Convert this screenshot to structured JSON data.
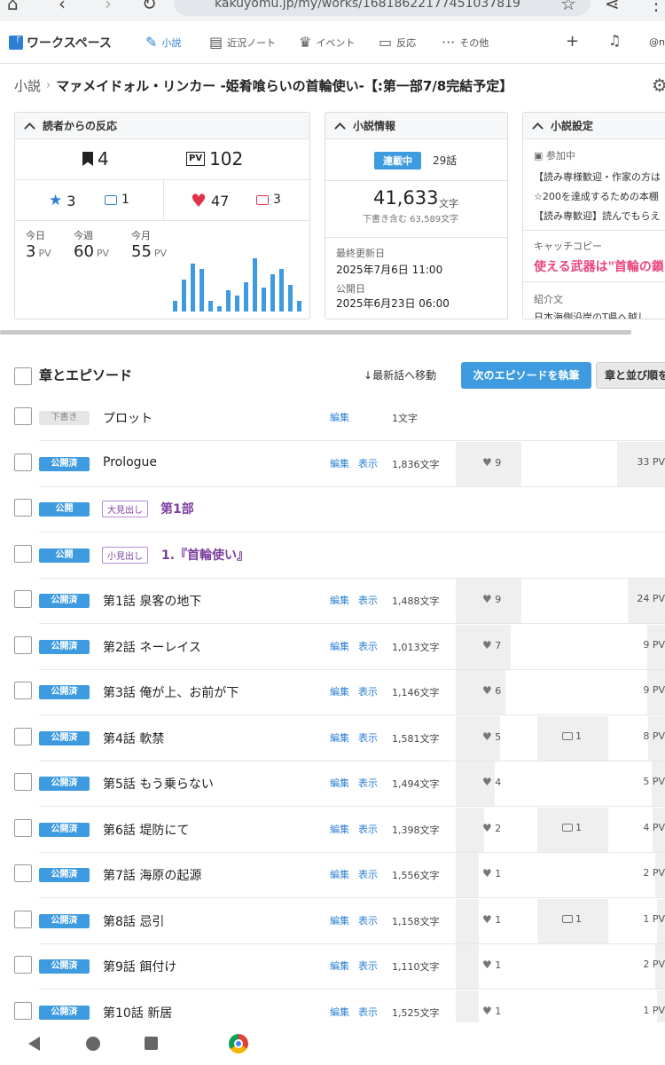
{
  "browser": {
    "url": "kakuyomu.jp/my/works/16818622177451037819"
  },
  "app": {
    "logo": "ワークスペース",
    "nav": [
      {
        "label": "小説",
        "icon": "book-icon"
      },
      {
        "label": "近況ノート",
        "icon": "notebook-icon"
      },
      {
        "label": "イベント",
        "icon": "crown-icon"
      },
      {
        "label": "反応",
        "icon": "comment-icon"
      },
      {
        "label": "その他",
        "icon": "more-icon"
      }
    ],
    "user": "@n"
  },
  "breadcrumb": {
    "root": "小説",
    "title": "マァメイドォル・リンカー -姫肴喰らいの首輪使い-【:第一部7/8完結予定】"
  },
  "reactions": {
    "title": "読者からの反応",
    "bookmarks": "4",
    "pv": "102",
    "stars": "3",
    "reviews": "1",
    "hearts": "47",
    "comments": "3",
    "periods": [
      {
        "label": "今日",
        "value": "3",
        "unit": "PV"
      },
      {
        "label": "今週",
        "value": "60",
        "unit": "PV"
      },
      {
        "label": "今月",
        "value": "55",
        "unit": "PV"
      }
    ],
    "bar_levels": [
      0.2,
      0.6,
      0.9,
      0.8,
      0.2,
      0.1,
      0.4,
      0.3,
      0.55,
      1.0,
      0.45,
      0.7,
      0.8,
      0.5,
      0.2
    ]
  },
  "info": {
    "title": "小説情報",
    "status": "連載中",
    "episodes": "29話",
    "chars": "41,633",
    "chars_unit": "文字",
    "chars_draft": "下書き含む 63,589文字",
    "updated_label": "最終更新日",
    "updated": "2025年7月6日 11:00",
    "published_label": "公開日",
    "published": "2025年6月23日 06:00"
  },
  "settings": {
    "title": "小説設定",
    "joining_label": "参加中",
    "lines": [
      "【読み専様歓迎・作家の方は",
      "☆200を達成するための本棚",
      "【読み専歓迎】読んでもらえ"
    ],
    "catch_label": "キャッチコピー",
    "catch": "使える武器は\"首輪の鎖",
    "intro_label": "紹介文",
    "intro": "日本海側沿岸のT県へ越し"
  },
  "episodes": {
    "title": "章とエピソード",
    "jump": "最新話へ移動",
    "new_btn": "次のエピソードを執筆",
    "sort_btn": "章と並び順を",
    "edit": "編集",
    "view": "表示",
    "rows": [
      {
        "kind": "ep",
        "status": "下書き",
        "draft": true,
        "title": "プロット",
        "chars": "1文字",
        "hearts": "",
        "comments": "",
        "pv": "",
        "view": false
      },
      {
        "kind": "ep",
        "status": "公開済",
        "title": "Prologue",
        "chars": "1,836文字",
        "hearts": "9",
        "comments": "",
        "pv": "33 PV",
        "heart_level": 0.9,
        "pv_level": 1.0,
        "view": true
      },
      {
        "kind": "chap",
        "status": "公開",
        "tag": "大見出し",
        "title": "第1部"
      },
      {
        "kind": "chap",
        "status": "公開",
        "tag": "小見出し",
        "title": "1.『首輪使い』"
      },
      {
        "kind": "ep",
        "status": "公開済",
        "title": "第1話 泉客の地下",
        "chars": "1,488文字",
        "hearts": "9",
        "comments": "",
        "pv": "24 PV",
        "heart_level": 0.9,
        "pv_level": 0.73,
        "view": true
      },
      {
        "kind": "ep",
        "status": "公開済",
        "title": "第2話 ネーレイス",
        "chars": "1,013文字",
        "hearts": "7",
        "comments": "",
        "pv": "9 PV",
        "heart_level": 0.7,
        "pv_level": 0.27,
        "view": true
      },
      {
        "kind": "ep",
        "status": "公開済",
        "title": "第3話 俺が上、お前が下",
        "chars": "1,146文字",
        "hearts": "6",
        "comments": "",
        "pv": "9 PV",
        "heart_level": 0.6,
        "pv_level": 0.27,
        "view": true
      },
      {
        "kind": "ep",
        "status": "公開済",
        "title": "第4話 軟禁",
        "chars": "1,581文字",
        "hearts": "5",
        "comments": "1",
        "pv": "8 PV",
        "heart_level": 0.5,
        "pv_level": 0.24,
        "view": true
      },
      {
        "kind": "ep",
        "status": "公開済",
        "title": "第5話 もう乗らない",
        "chars": "1,494文字",
        "hearts": "4",
        "comments": "",
        "pv": "5 PV",
        "heart_level": 0.4,
        "pv_level": 0.15,
        "view": true
      },
      {
        "kind": "ep",
        "status": "公開済",
        "title": "第6話 堤防にて",
        "chars": "1,398文字",
        "hearts": "2",
        "comments": "1",
        "pv": "4 PV",
        "heart_level": 0.2,
        "pv_level": 0.12,
        "view": true
      },
      {
        "kind": "ep",
        "status": "公開済",
        "title": "第7話 海原の起源",
        "chars": "1,556文字",
        "hearts": "1",
        "comments": "",
        "pv": "2 PV",
        "heart_level": 0.1,
        "pv_level": 0.06,
        "view": true
      },
      {
        "kind": "ep",
        "status": "公開済",
        "title": "第8話 忌引",
        "chars": "1,158文字",
        "hearts": "1",
        "comments": "1",
        "pv": "1 PV",
        "heart_level": 0.1,
        "pv_level": 0.03,
        "view": true
      },
      {
        "kind": "ep",
        "status": "公開済",
        "title": "第9話 餌付け",
        "chars": "1,110文字",
        "hearts": "1",
        "comments": "",
        "pv": "2 PV",
        "heart_level": 0.1,
        "pv_level": 0.06,
        "view": true
      },
      {
        "kind": "ep",
        "status": "公開済",
        "title": "第10話 新居",
        "chars": "1,525文字",
        "hearts": "1",
        "comments": "",
        "pv": "1 PV",
        "heart_level": 0.1,
        "pv_level": 0.03,
        "view": true
      }
    ]
  },
  "colors": {
    "accent": "#3f9be0",
    "heart": "#e0334a",
    "catch": "#e8477b",
    "chapter": "#7b3fa0"
  }
}
